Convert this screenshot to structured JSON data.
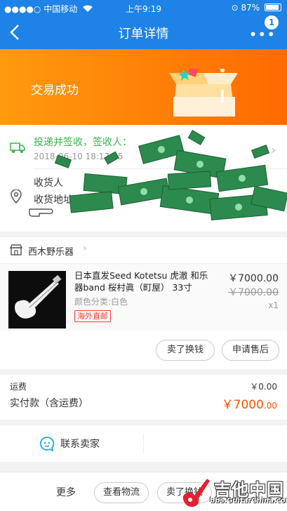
{
  "status_bar": {
    "carrier": "中国移动",
    "time": "上午9:19",
    "battery": "87%"
  },
  "nav": {
    "title": "订单详情",
    "badge_count": "1"
  },
  "hero": {
    "status": "交易成功"
  },
  "logistics": {
    "status": "投递并签收，签收人：",
    "time": "2018-06-10 18:17:15"
  },
  "address": {
    "receiver_line": "收货人",
    "address_line": "收货地址"
  },
  "shop": {
    "name": "西木野乐器"
  },
  "item": {
    "title": "日本直发Seed Kotetsu 虎澈 和乐器band 桜村眞（町屋） 33寸",
    "spec": "颜色分类:白色",
    "tag": "海外直邮",
    "price": "￥7000.00",
    "original_price": "￥7000.00",
    "quantity": "x1"
  },
  "item_actions": {
    "swap_label": "卖了换钱",
    "aftersale_label": "申请售后"
  },
  "fees": {
    "shipping_label": "运费",
    "shipping_value": "￥0.00",
    "paid_label": "实付款（含运费）",
    "paid_value_main": "￥7000",
    "paid_value_decimal": ".00"
  },
  "contact": {
    "label": "联系卖家"
  },
  "bottom_bar": {
    "more_label": "更多",
    "logistics_label": "查看物流",
    "sell_label": "卖了换钱"
  },
  "watermark": {
    "main": "吉他中国",
    "sub": "bbs.GuitarChina.com"
  },
  "colors": {
    "primary": "#1e82e6",
    "hero_orange": "#ff7a00",
    "price_orange": "#ff5000",
    "logistics_green": "#3cb34a",
    "tag_red": "#ff3b30"
  }
}
